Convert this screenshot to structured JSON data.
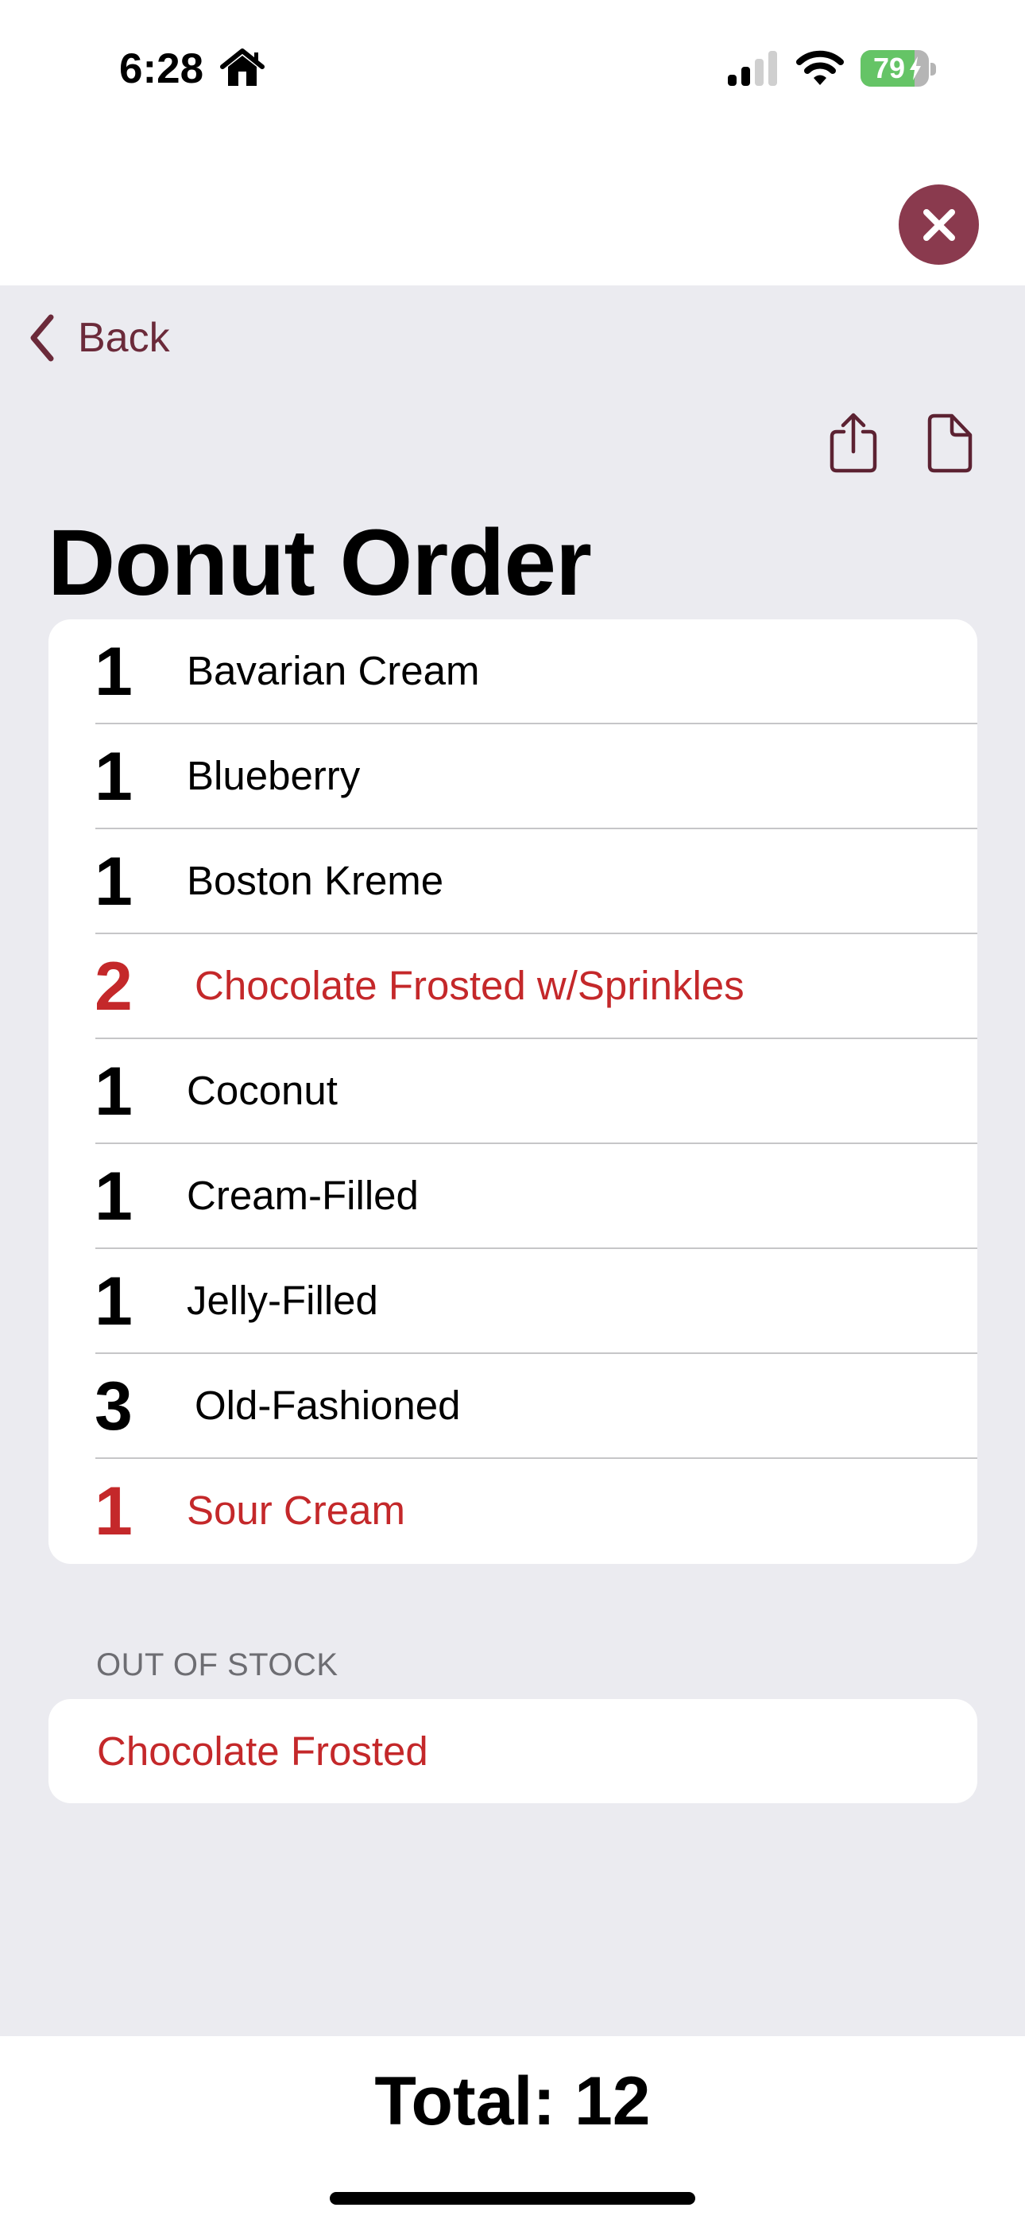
{
  "status_bar": {
    "time": "6:28",
    "focus_icon": "home-icon",
    "signal_bars_active": 2,
    "signal_bars_total": 4,
    "wifi_icon": "wifi-icon",
    "battery_percent": "79",
    "battery_level": 0.79,
    "battery_charging": true,
    "battery_color": "#65c466"
  },
  "header": {
    "close_icon": "close-icon",
    "close_color": "#8a3a4e"
  },
  "nav": {
    "back_label": "Back",
    "accent_color": "#6b2a3a",
    "share_icon": "share-icon",
    "document_icon": "document-icon"
  },
  "page": {
    "title": "Donut Order"
  },
  "order": {
    "alert_color": "#c4282a",
    "items": [
      {
        "qty": "1",
        "name": "Bavarian Cream",
        "alert": false
      },
      {
        "qty": "1",
        "name": "Blueberry",
        "alert": false
      },
      {
        "qty": "1",
        "name": "Boston Kreme",
        "alert": false
      },
      {
        "qty": "2",
        "name": "Chocolate Frosted w/Sprinkles",
        "alert": true
      },
      {
        "qty": "1",
        "name": "Coconut",
        "alert": false
      },
      {
        "qty": "1",
        "name": "Cream-Filled",
        "alert": false
      },
      {
        "qty": "1",
        "name": "Jelly-Filled",
        "alert": false
      },
      {
        "qty": "3",
        "name": "Old-Fashioned",
        "alert": false
      },
      {
        "qty": "1",
        "name": "Sour Cream",
        "alert": true
      }
    ]
  },
  "out_of_stock": {
    "header": "OUT OF STOCK",
    "items": [
      {
        "name": "Chocolate Frosted"
      }
    ]
  },
  "footer": {
    "total_label": "Total: 12"
  }
}
